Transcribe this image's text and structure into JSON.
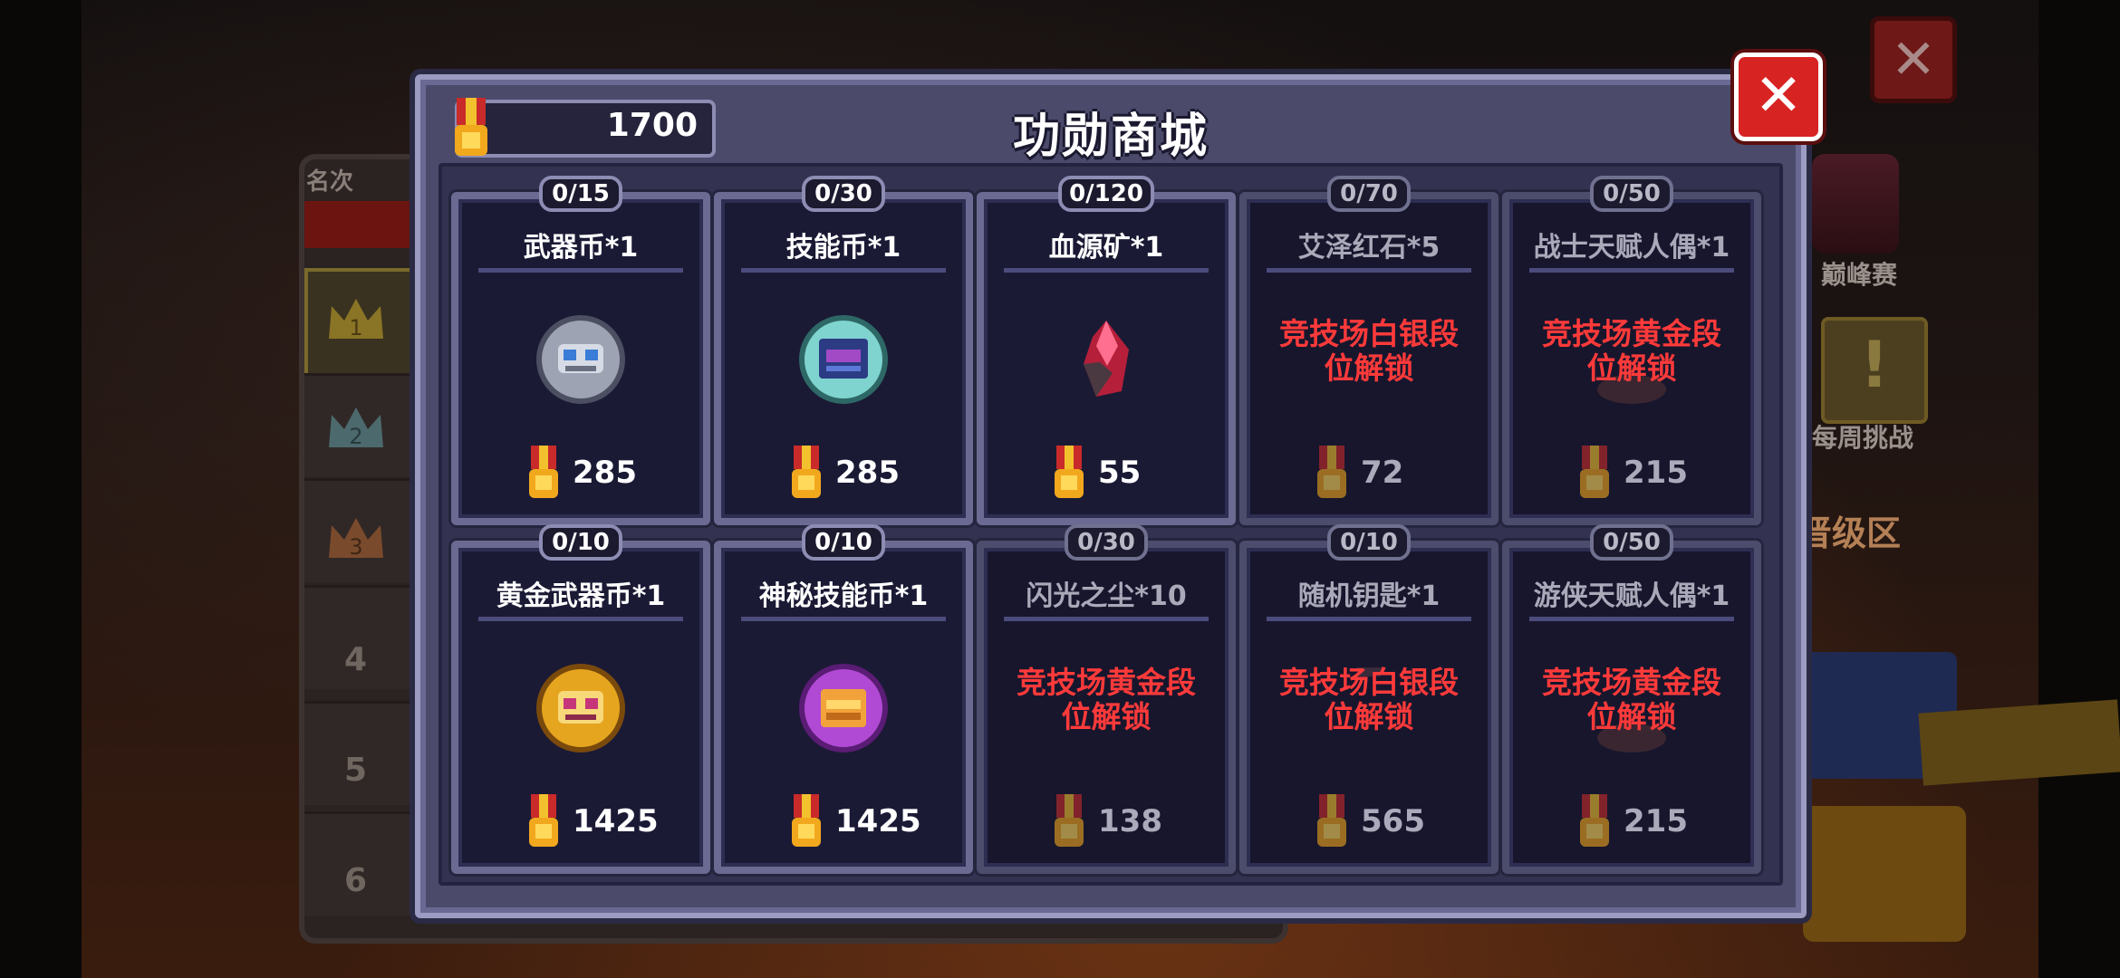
{
  "background": {
    "rank_label": "名次",
    "rank_numbers": [
      "4",
      "5",
      "6"
    ],
    "right_labels": {
      "apex": "巅峰赛",
      "weekly": "每周挑战",
      "promotion": "晋级区"
    },
    "bg_close_glyph": "✕",
    "weekly_glyph": "!"
  },
  "store": {
    "title": "功勋商城",
    "currency": {
      "value": "1700",
      "icon": "medal-icon"
    },
    "close_glyph": "✕",
    "items": [
      {
        "limit": "0/15",
        "name": "武器币*1",
        "price": "285",
        "icon": "weapon-coin-icon",
        "locked": false,
        "lock_text": ""
      },
      {
        "limit": "0/30",
        "name": "技能币*1",
        "price": "285",
        "icon": "skill-coin-icon",
        "locked": false,
        "lock_text": ""
      },
      {
        "limit": "0/120",
        "name": "血源矿*1",
        "price": "55",
        "icon": "blood-ore-icon",
        "locked": false,
        "lock_text": ""
      },
      {
        "limit": "0/70",
        "name": "艾泽红石*5",
        "price": "72",
        "icon": "red-stone-icon",
        "locked": true,
        "lock_text": "竞技场白银段\n位解锁"
      },
      {
        "limit": "0/50",
        "name": "战士天赋人偶*1",
        "price": "215",
        "icon": "warrior-doll-icon",
        "locked": true,
        "lock_text": "竞技场黄金段\n位解锁"
      },
      {
        "limit": "0/10",
        "name": "黄金武器币*1",
        "price": "1425",
        "icon": "gold-weapon-coin-icon",
        "locked": false,
        "lock_text": ""
      },
      {
        "limit": "0/10",
        "name": "神秘技能币*1",
        "price": "1425",
        "icon": "mystic-skill-coin-icon",
        "locked": false,
        "lock_text": ""
      },
      {
        "limit": "0/30",
        "name": "闪光之尘*10",
        "price": "138",
        "icon": "flash-dust-icon",
        "locked": true,
        "lock_text": "竞技场黄金段\n位解锁"
      },
      {
        "limit": "0/10",
        "name": "随机钥匙*1",
        "price": "565",
        "icon": "random-key-icon",
        "locked": true,
        "lock_text": "竞技场白银段\n位解锁"
      },
      {
        "limit": "0/50",
        "name": "游侠天赋人偶*1",
        "price": "215",
        "icon": "ranger-doll-icon",
        "locked": true,
        "lock_text": "竞技场黄金段\n位解锁"
      }
    ]
  },
  "colors": {
    "lock_text": "#ff3a3a",
    "close_button": "#d82323",
    "dialog_bg": "#4b4a6b",
    "card_bg": "#1b1a35"
  }
}
